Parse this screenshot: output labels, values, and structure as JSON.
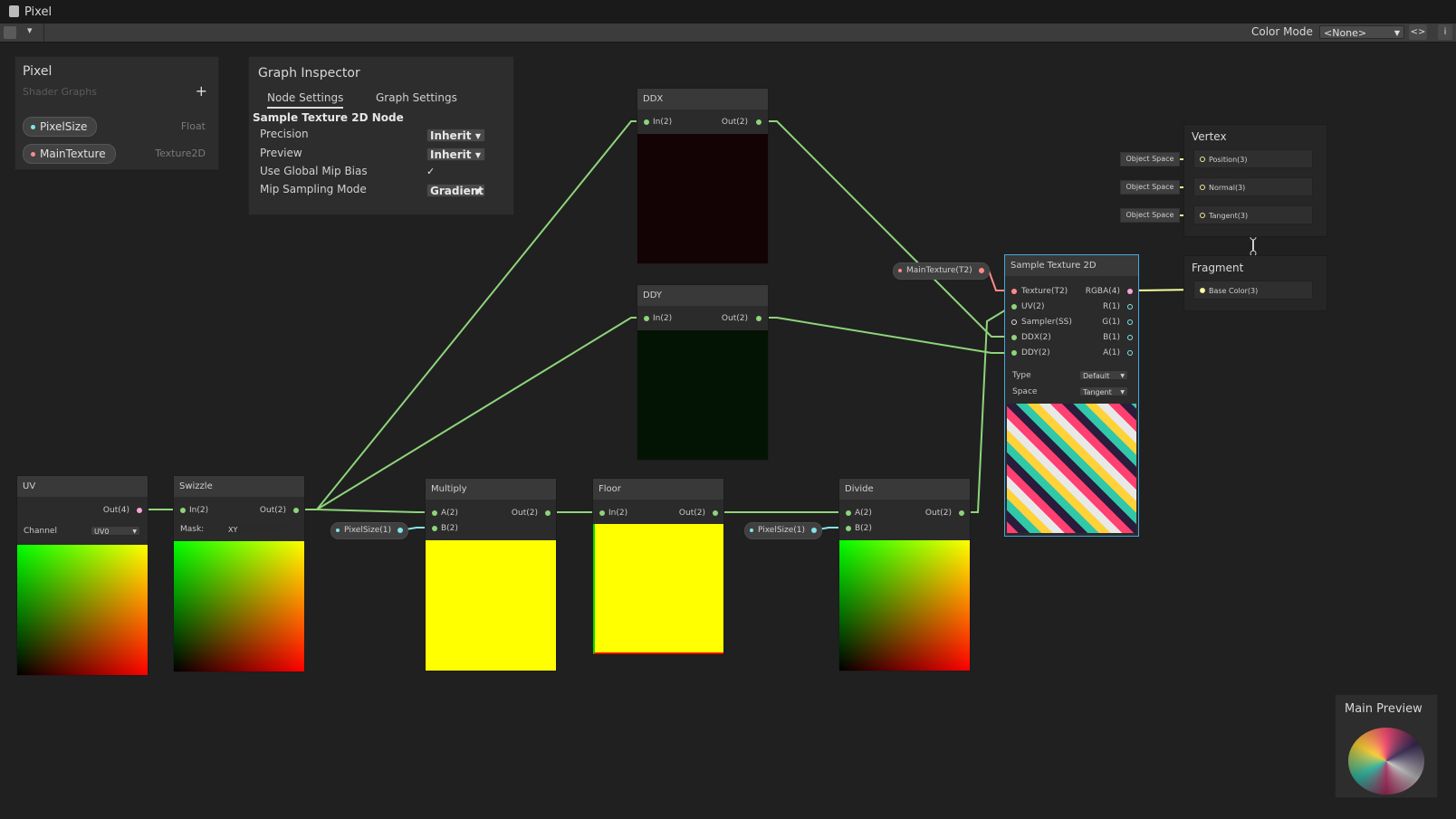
{
  "window": {
    "title": "Pixel"
  },
  "toolbar": {
    "dropdown_glyph": "▾",
    "color_mode_label": "Color Mode",
    "color_mode_value": "<None>",
    "btn_code": "<>",
    "btn_info": "i"
  },
  "blackboard": {
    "title": "Pixel",
    "subtitle": "Shader Graphs",
    "add_label": "+",
    "properties": [
      {
        "name": "PixelSize",
        "type": "Float"
      },
      {
        "name": "MainTexture",
        "type": "Texture2D"
      }
    ]
  },
  "graph_inspector": {
    "title": "Graph Inspector",
    "tabs": [
      "Node Settings",
      "Graph Settings"
    ],
    "active_tab": "Node Settings",
    "section_title": "Sample Texture 2D Node",
    "settings": [
      {
        "label": "Precision",
        "value": "Inherit"
      },
      {
        "label": "Preview",
        "value": "Inherit"
      },
      {
        "label": "Use Global Mip Bias",
        "value": "✓"
      },
      {
        "label": "Mip Sampling Mode",
        "value": "Gradient"
      }
    ]
  },
  "nodes": {
    "ddx": {
      "title": "DDX",
      "in": "In(2)",
      "out": "Out(2)"
    },
    "ddy": {
      "title": "DDY",
      "in": "In(2)",
      "out": "Out(2)"
    },
    "uv": {
      "title": "UV",
      "out": "Out(4)",
      "prop_label": "Channel",
      "prop_value": "UV0"
    },
    "swizzle": {
      "title": "Swizzle",
      "in": "In(2)",
      "out": "Out(2)",
      "prop_label": "Mask:",
      "prop_value": "XY"
    },
    "multiply": {
      "title": "Multiply",
      "a": "A(2)",
      "b": "B(2)",
      "out": "Out(2)"
    },
    "floor": {
      "title": "Floor",
      "in": "In(2)",
      "out": "Out(2)"
    },
    "divide": {
      "title": "Divide",
      "a": "A(2)",
      "b": "B(2)",
      "out": "Out(2)"
    },
    "sample": {
      "title": "Sample Texture 2D",
      "inputs": [
        "Texture(T2)",
        "UV(2)",
        "Sampler(SS)",
        "DDX(2)",
        "DDY(2)"
      ],
      "outputs": [
        "RGBA(4)",
        "R(1)",
        "G(1)",
        "B(1)",
        "A(1)"
      ],
      "type_label": "Type",
      "type_value": "Default",
      "space_label": "Space",
      "space_value": "Tangent"
    }
  },
  "property_nodes": {
    "pixelsize_1": "PixelSize(1)",
    "pixelsize_2": "PixelSize(1)",
    "maintexture": "MainTexture(T2)"
  },
  "master": {
    "vertex": {
      "title": "Vertex",
      "slots": [
        "Position(3)",
        "Normal(3)",
        "Tangent(3)"
      ],
      "space_labels": [
        "Object Space",
        "Object Space",
        "Object Space"
      ]
    },
    "fragment": {
      "title": "Fragment",
      "slots": [
        "Base Color(3)"
      ]
    }
  },
  "main_preview": {
    "title": "Main Preview"
  },
  "colors": {
    "vec2": "#8ed47a",
    "vec4": "#f8a3d8",
    "float": "#84e4e7",
    "texture": "#ff8b8b",
    "vec3": "#f6ff9a",
    "selection": "#44a8e0"
  }
}
